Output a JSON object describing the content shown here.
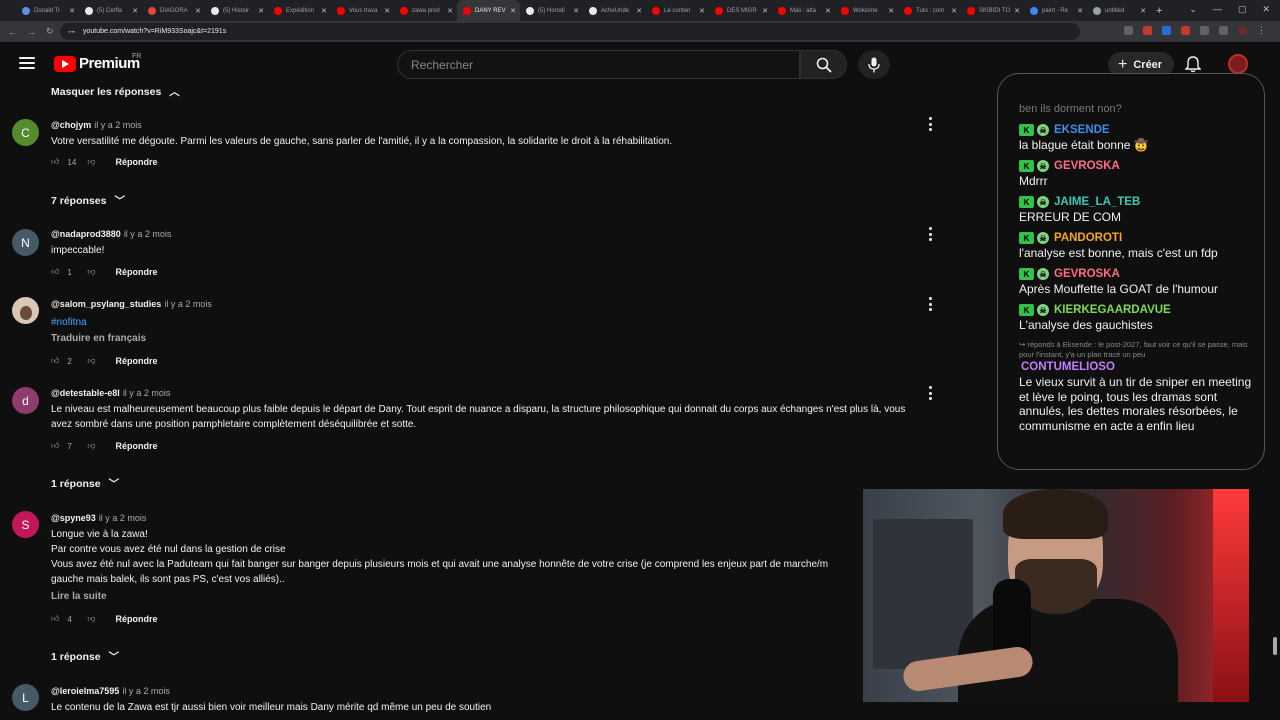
{
  "browser": {
    "tabs": [
      {
        "label": "Donald Tr",
        "color": "#5b8def"
      },
      {
        "label": "(5) Cerfla",
        "color": "#e8eaed"
      },
      {
        "label": "DIAGORA",
        "color": "#ea4335"
      },
      {
        "label": "(5) Histoir",
        "color": "#e8eaed"
      },
      {
        "label": "Expédition",
        "color": "#ff0000"
      },
      {
        "label": "Vous trava",
        "color": "#ff0000"
      },
      {
        "label": "zawa prod",
        "color": "#ff0000"
      },
      {
        "label": "DANY REV",
        "color": "#ff0000"
      },
      {
        "label": "(5) Horodi",
        "color": "#e8eaed"
      },
      {
        "label": "AcheUnde",
        "color": "#e8eaed"
      },
      {
        "label": "Le conten",
        "color": "#ff0000"
      },
      {
        "label": "DES MIGR",
        "color": "#ff0000"
      },
      {
        "label": "Mali : atta",
        "color": "#ff0000"
      },
      {
        "label": "Wokisme",
        "color": "#ff0000"
      },
      {
        "label": "Tuto : com",
        "color": "#ff0000"
      },
      {
        "label": "SKIBIDI TO",
        "color": "#ff0000"
      },
      {
        "label": "paint - Re",
        "color": "#4285f4"
      },
      {
        "label": "untitled",
        "color": "#9aa0a6"
      }
    ],
    "active_tab_index": 7,
    "url": "youtube.com/watch?v=RiM933Soajc&t=2191s"
  },
  "header": {
    "logo_text": "Premium",
    "country": "FR",
    "search_placeholder": "Rechercher",
    "create_label": "Créer"
  },
  "comments": {
    "hide_replies": "Masquer les réponses",
    "items": [
      {
        "avatar_letter": "C",
        "avatar_color": "#558b2f",
        "handle": "@chojym",
        "time": "il y a 2 mois",
        "lines": [
          "Votre versatilité me dégoute. Parmi les valeurs de gauche, sans parler de l'amitié,   il y a la compassion, la solidarite le droit à la réhabilitation."
        ],
        "likes": "14",
        "reply": "Répondre"
      },
      {
        "avatar_letter": "N",
        "avatar_color": "#455a64",
        "handle": "@nadaprod3880",
        "time": "il y a 2 mois",
        "lines": [
          "impeccable!"
        ],
        "likes": "1",
        "reply": "Répondre"
      },
      {
        "avatar_letter": "",
        "avatar_color": "#d8c7b8",
        "handle": "@salom_psylang_studies",
        "time": "il y a 2 mois",
        "hashtag": "#nofitna",
        "translate": "Traduire en français",
        "likes": "2",
        "reply": "Répondre"
      },
      {
        "avatar_letter": "d",
        "avatar_color": "#8e3b6e",
        "handle": "@detestable-e8l",
        "time": "il y a 2 mois",
        "lines": [
          "Le niveau est malheureusement beaucoup plus faible depuis le départ de Dany. Tout esprit de nuance a disparu, la structure philosophique qui donnait du corps aux échanges n'est plus là, vous",
          "avez sombré dans une position pamphletaire complètement déséquilibrée et sotte."
        ],
        "likes": "7",
        "reply": "Répondre"
      },
      {
        "avatar_letter": "S",
        "avatar_color": "#c2185b",
        "handle": "@spyne93",
        "time": "il y a 2 mois",
        "lines": [
          "Longue vie à la zawa!",
          "Par contre vous avez été nul dans la gestion de crise",
          "Vous avez été nul avec la Paduteam qui fait banger sur banger depuis plusieurs mois et qui avait une analyse honnête de votre crise (je comprend les enjeux part de marche/m",
          "gauche mais balek, ils sont pas PS, c'est vos alliés).."
        ],
        "read_more": "Lire la suite",
        "likes": "4",
        "reply": "Répondre"
      },
      {
        "avatar_letter": "L",
        "avatar_color": "#455a64",
        "handle": "@leroielma7595",
        "time": "il y a 2 mois",
        "lines": [
          "Le contenu de la Zawa est tjr aussi bien voir meilleur mais Dany mérite qd même un peu de soutien"
        ]
      }
    ],
    "replies_7": "7 réponses",
    "replies_1a": "1 réponse",
    "replies_1b": "1 réponse"
  },
  "chat": {
    "faded_line": "ben ils dorment non?",
    "messages": [
      {
        "user": "EKSENDE",
        "color": "#3e8de8",
        "text": "la blague était bonne 🤠"
      },
      {
        "user": "GEVROSKA",
        "color": "#ff6b8b",
        "text": "Mdrrr"
      },
      {
        "user": "JAIME_LA_TEB",
        "color": "#3ec9b4",
        "text": "ERREUR DE COM"
      },
      {
        "user": "PANDOROTI",
        "color": "#f5a623",
        "text": "l'analyse est bonne, mais c'est un fdp"
      },
      {
        "user": "GEVROSKA",
        "color": "#ff6b8b",
        "text": "Après Mouffette la GOAT de l'humour"
      },
      {
        "user": "KIERKEGAARDAVUE",
        "color": "#7ed957",
        "text": "L'analyse des gauchistes"
      }
    ],
    "reply_context": "↪ réponds à Eksende : le post-2027, faut voir ce qu'il se passe, mais pour l'instant, y'a un plan tracé un peu",
    "last_user": "CONTUMELIOSO",
    "last_user_color": "#c77dff",
    "last_text": "Le vieux survit à un tir de sniper en meeting et lève le poing, tous les dramas sont annulés, les dettes morales résorbées, le communisme en acte a enfin lieu"
  }
}
